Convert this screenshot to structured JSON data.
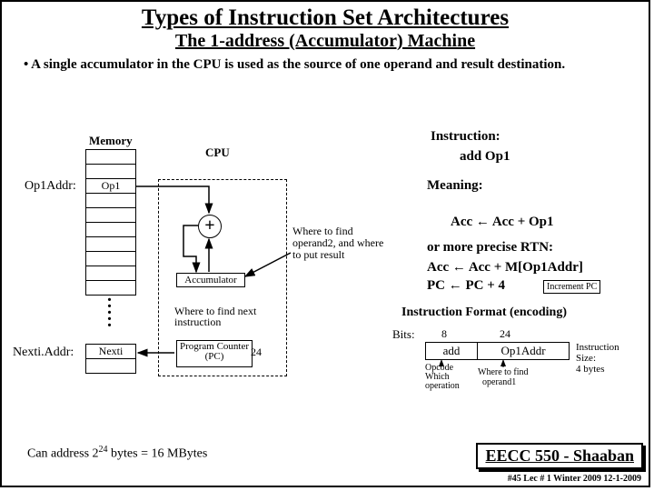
{
  "title": "Types of Instruction Set Architectures",
  "subtitle": "The 1-address (Accumulator) Machine",
  "bullet1": "• A single accumulator in the CPU is used as the source of one operand and result destination.",
  "labels": {
    "memory": "Memory",
    "cpu": "CPU",
    "op1addr": "Op1Addr:",
    "op1": "Op1",
    "nextiaddr": "Nexti.Addr:",
    "nexti": "Nexti",
    "accumulator": "Accumulator",
    "pc": "Program Counter (PC)",
    "pc24": "24",
    "where_next": "Where to find next instruction",
    "where_op2": "Where to find operand2, and where to put result",
    "plus": "+"
  },
  "right": {
    "instr_hdr": "Instruction:",
    "instr": "add Op1",
    "meaning_hdr": "Meaning:",
    "acc_eq": "Acc ← Acc + Op1",
    "precise": "or more precise RTN:",
    "rtn1": "Acc ← Acc + M[Op1Addr]",
    "rtn2": "PC ← PC + 4",
    "incpc": "Increment PC",
    "fmt_hdr": "Instruction Format (encoding)",
    "bits": "Bits:",
    "b8": "8",
    "b24": "24",
    "fmt_add": "add",
    "fmt_op1": "Op1Addr",
    "opcode1": "Opcode",
    "opcode2": "Which",
    "opcode3": "operation",
    "where1a": "Where to find",
    "where1b": "operand1",
    "size1": "Instruction",
    "size2": "Size:",
    "size3": "4 bytes"
  },
  "bottom": {
    "can": "Can address 2",
    "exp": "24",
    "rest": " bytes = 16 MBytes"
  },
  "footer": {
    "course": "EECC 550 - Shaaban",
    "meta": "#45  Lec # 1  Winter 2009  12-1-2009"
  }
}
